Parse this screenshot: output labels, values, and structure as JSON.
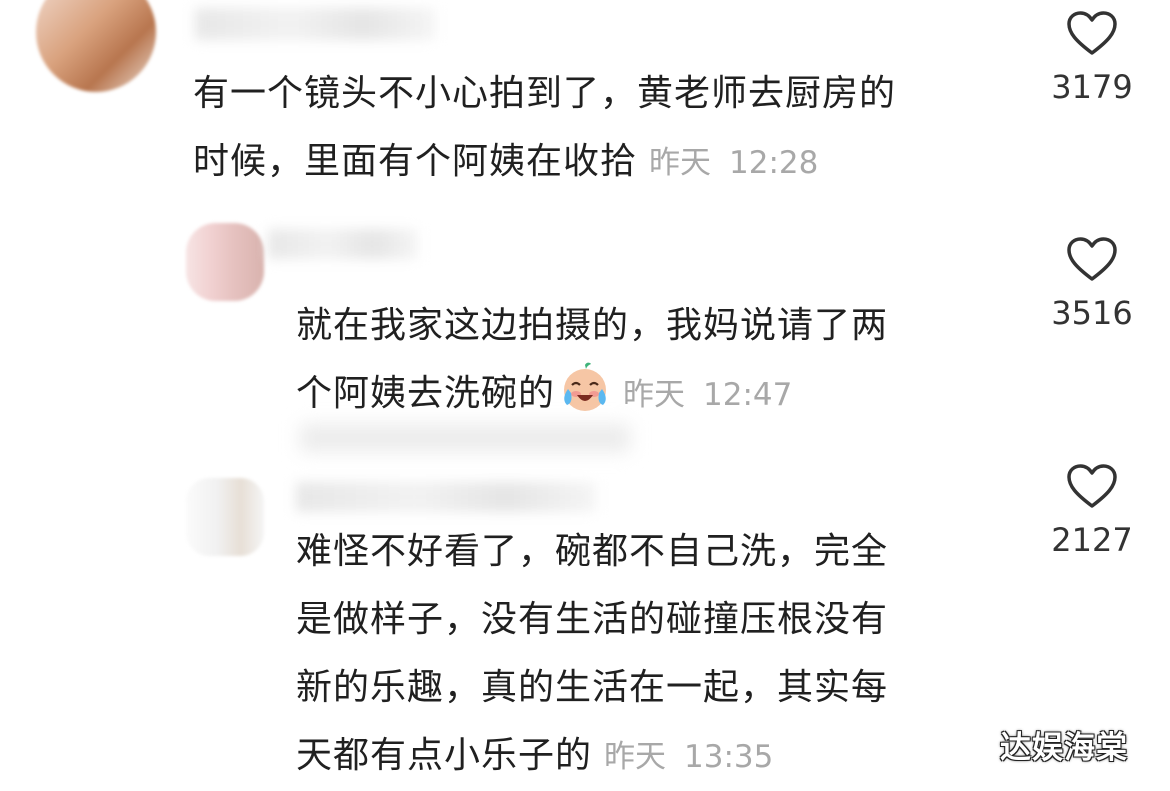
{
  "comments": [
    {
      "text": "有一个镜头不小心拍到了，黄老师去厨房的",
      "text_line2": "时候，里面有个阿姨在收拾",
      "date": "昨天",
      "time": "12:28",
      "likes": "3179"
    },
    {
      "text": "就在我家这边拍摄的，我妈说请了两",
      "text_line2": "个阿姨去洗碗的",
      "emoji": "crying-laughing-emoji",
      "date": "昨天",
      "time": "12:47",
      "likes": "3516"
    },
    {
      "text": "难怪不好看了，碗都不自己洗，完全",
      "text_line2": "是做样子，没有生活的碰撞压根没有",
      "text_line3": "新的乐趣，真的生活在一起，其实每",
      "text_line4": "天都有点小乐子的",
      "date": "昨天",
      "time": "13:35",
      "likes": "2127"
    }
  ],
  "watermark": "达娱海棠",
  "colors": {
    "text": "#202020",
    "timestamp": "#a8a8a8",
    "heart_outline": "#333333"
  }
}
